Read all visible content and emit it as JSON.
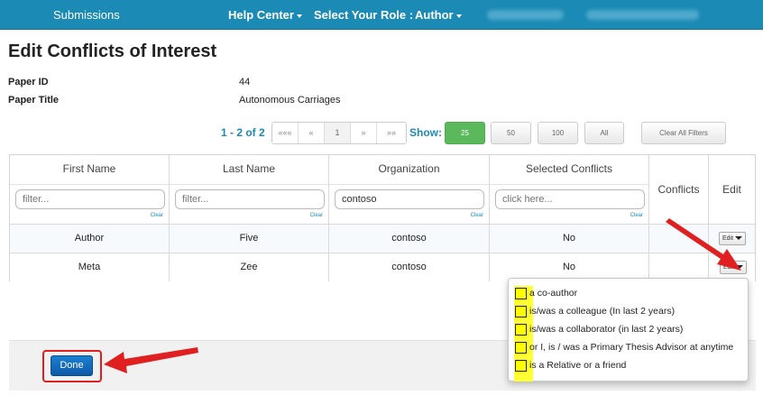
{
  "nav": {
    "submissions": "Submissions",
    "help_center": "Help Center",
    "role_label": "Select Your Role :",
    "role_value": "Author"
  },
  "page": {
    "title": "Edit Conflicts of Interest",
    "paper_id_label": "Paper ID",
    "paper_id_value": "44",
    "paper_title_label": "Paper Title",
    "paper_title_value": "Autonomous Carriages"
  },
  "pagination": {
    "range": "1 - 2 of 2",
    "first": "«««",
    "prev": "«",
    "current": "1",
    "next": "»",
    "last": "»»",
    "show_label": "Show:",
    "sizes": [
      "25",
      "50",
      "100",
      "All"
    ],
    "active_size": "25",
    "clear_filters": "Clear All Filters"
  },
  "table": {
    "headers": {
      "first_name": "First Name",
      "last_name": "Last Name",
      "organization": "Organization",
      "selected_conflicts": "Selected Conflicts",
      "conflicts": "Conflicts",
      "edit": "Edit"
    },
    "filters": {
      "first_name_placeholder": "filter...",
      "last_name_placeholder": "filter...",
      "organization_value": "contoso",
      "conflicts_placeholder": "click here...",
      "clear_label": "Clear"
    },
    "rows": [
      {
        "first_name": "Author",
        "last_name": "Five",
        "organization": "contoso",
        "selected_conflicts": "No",
        "edit_label": "Edit"
      },
      {
        "first_name": "Meta",
        "last_name": "Zee",
        "organization": "contoso",
        "selected_conflicts": "No",
        "edit_label": "Edit"
      }
    ]
  },
  "dropdown": {
    "options": [
      "a co-author",
      "is/was a colleague (In last 2 years)",
      "is/was a collaborator (in last 2 years)",
      "or I, is / was a Primary Thesis Advisor at anytime",
      "is a Relative or a friend"
    ]
  },
  "footer": {
    "done_label": "Done"
  },
  "colors": {
    "nav_bg": "#1b8ab4",
    "accent": "#1b8ab4",
    "active_size": "#5cb85c",
    "done_button": "#0d5aa7",
    "annotation": "#e02020",
    "highlight": "#ffff00"
  }
}
